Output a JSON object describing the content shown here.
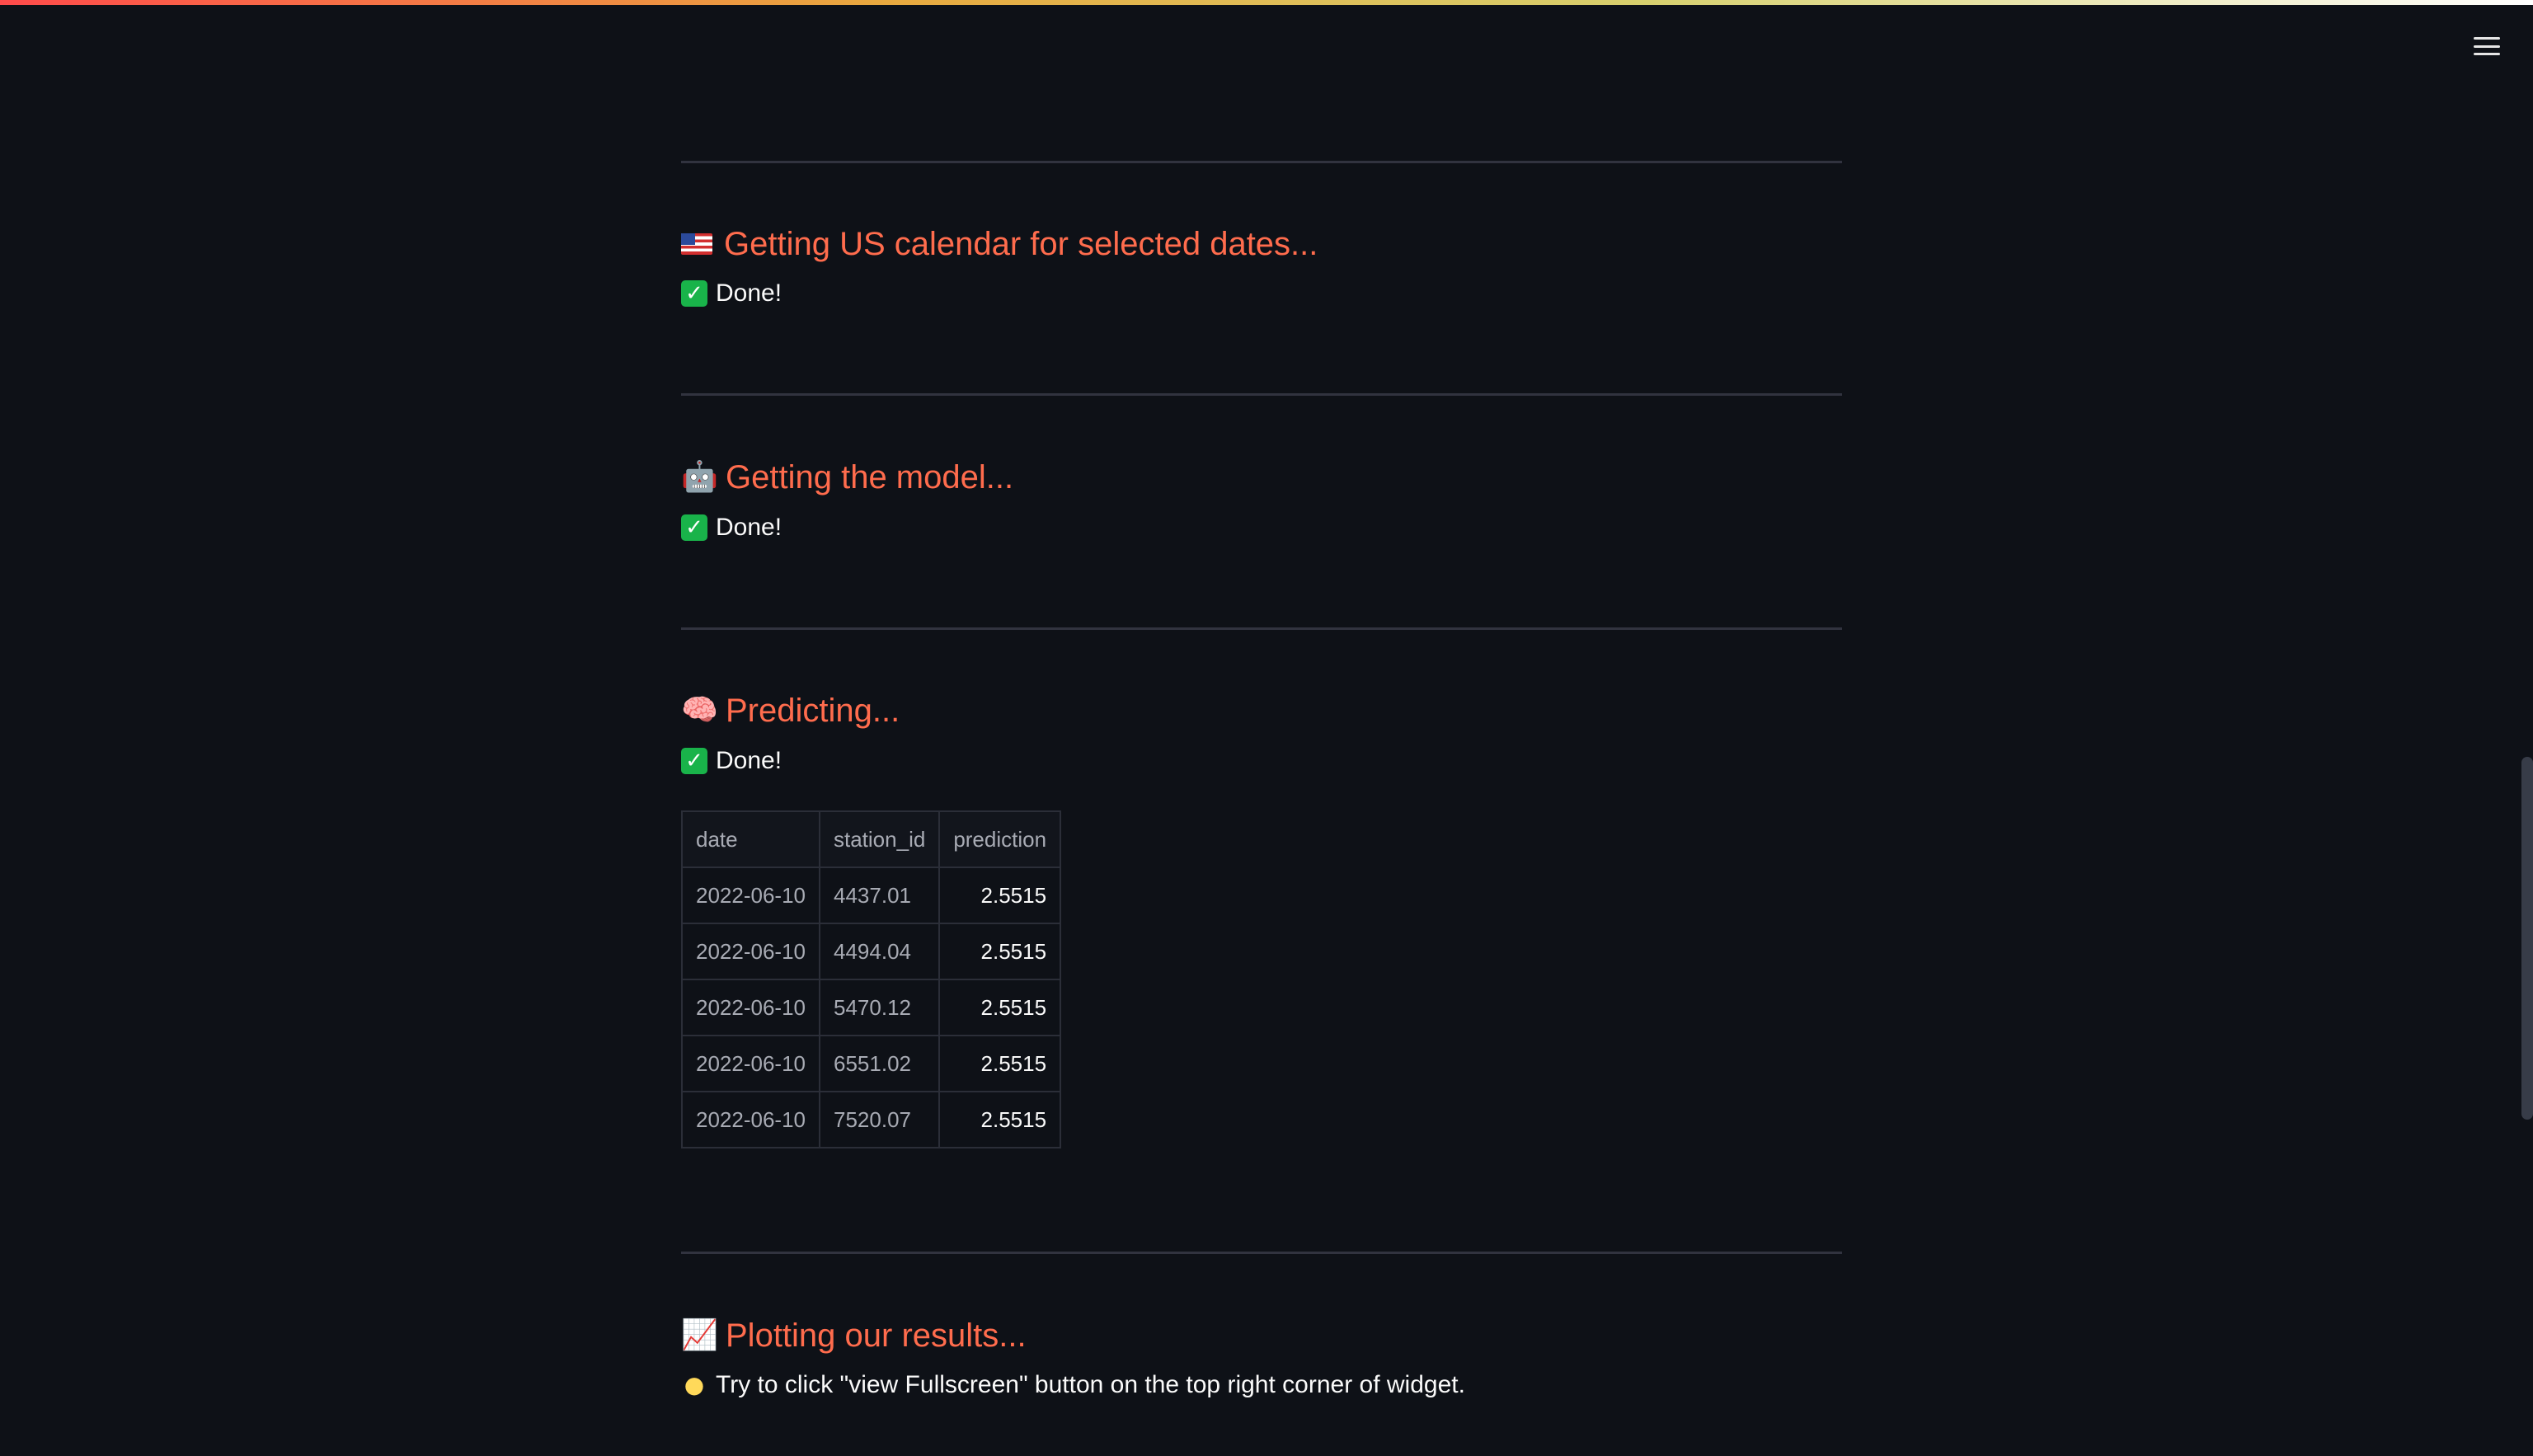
{
  "menu": {
    "icon": "hamburger-menu-icon"
  },
  "sections": {
    "calendar": {
      "icon": "us-flag-icon",
      "title": "Getting US calendar for selected dates...",
      "status": "Done!"
    },
    "model": {
      "icon": "robot-icon",
      "icon_glyph": "🤖",
      "title": "Getting the model...",
      "status": "Done!"
    },
    "predict": {
      "icon": "brain-icon",
      "icon_glyph": "🧠",
      "title": "Predicting...",
      "status": "Done!"
    },
    "plot": {
      "icon": "chart-increasing-icon",
      "icon_glyph": "📈",
      "title": "Plotting our results...",
      "tip_icon": "light-bulb-icon",
      "tip": "Try to click \"view Fullscreen\" button on the top right corner of widget."
    }
  },
  "check_icon": {
    "name": "check-mark-icon",
    "glyph": "✓",
    "color": "#19b34a"
  },
  "table": {
    "columns": [
      "date",
      "station_id",
      "prediction"
    ],
    "rows": [
      [
        "2022-06-10",
        "4437.01",
        "2.5515"
      ],
      [
        "2022-06-10",
        "4494.04",
        "2.5515"
      ],
      [
        "2022-06-10",
        "5470.12",
        "2.5515"
      ],
      [
        "2022-06-10",
        "6551.02",
        "2.5515"
      ],
      [
        "2022-06-10",
        "7520.07",
        "2.5515"
      ]
    ]
  },
  "colors": {
    "background": "#0e1117",
    "heading": "#ff6c4d",
    "text": "#fafafa",
    "divider": "#31333f"
  }
}
